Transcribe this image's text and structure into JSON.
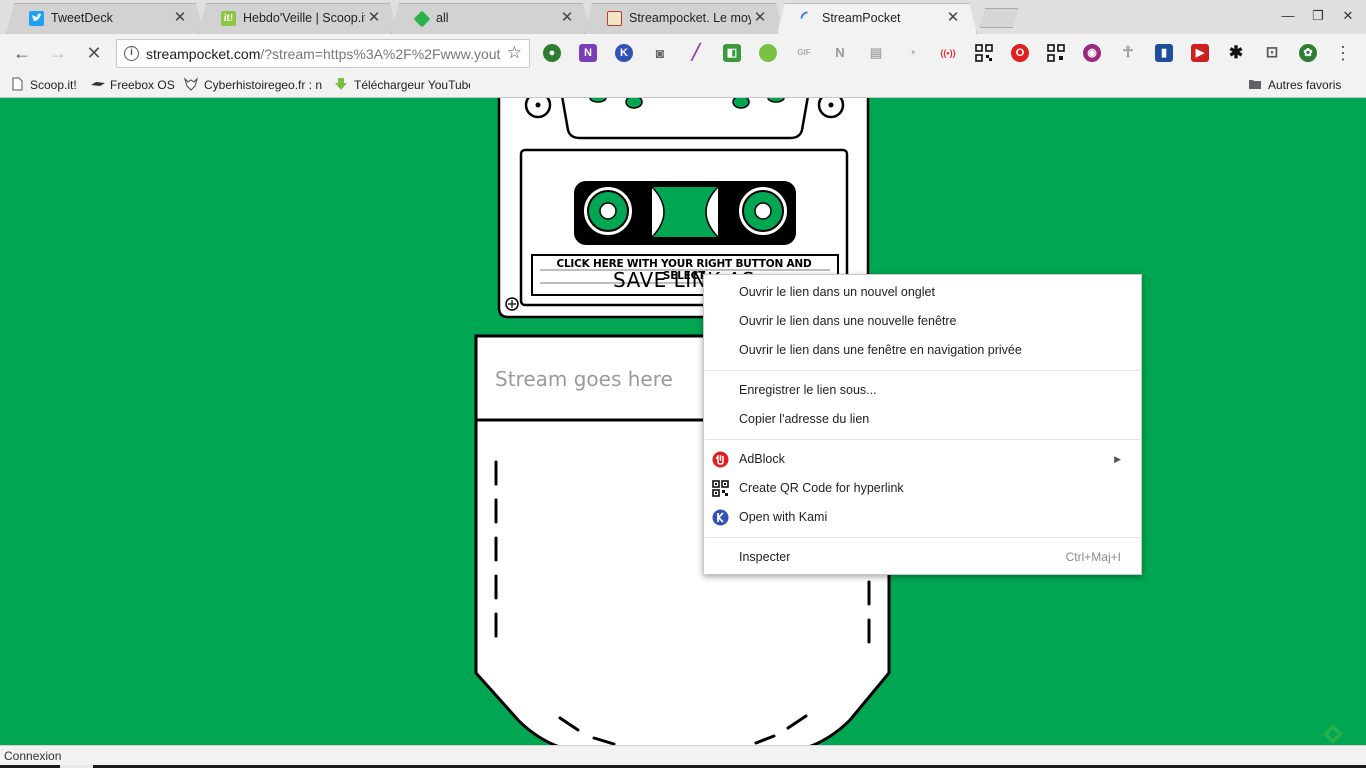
{
  "tabs": [
    {
      "title": "TweetDeck",
      "icon": "twitter-icon",
      "color": "#1da1f2"
    },
    {
      "title": "Hebdo'Veille | Scoop.it",
      "icon": "scoopit-icon",
      "color": "#8dc63f"
    },
    {
      "title": "all",
      "icon": "feedly-icon",
      "color": "#2bb24c"
    },
    {
      "title": "Streampocket. Le moye",
      "icon": "streampocket-icon",
      "color": "#c0392b"
    },
    {
      "title": "StreamPocket",
      "icon": "loading-spinner-icon",
      "color": "#888888"
    }
  ],
  "address_bar": {
    "url_host": "streampocket.com",
    "url_rest": "/?stream=https%3A%2F%2Fwww.yout"
  },
  "bookmarks": [
    {
      "label": "Scoop.it!",
      "icon": "page-icon"
    },
    {
      "label": "Freebox OS",
      "icon": "freebox-icon"
    },
    {
      "label": "Cyberhistoiregeo.fr : n",
      "icon": "wolf-icon"
    },
    {
      "label": "Téléchargeur YouTube",
      "icon": "download-arrow-icon"
    }
  ],
  "other_bookmarks": "Autres favoris",
  "page": {
    "cassette_line1": "CLICK HERE WITH YOUR RIGHT BUTTON AND SELECT",
    "cassette_line2": "SAVE LINK AS",
    "stream_placeholder": "Stream goes here",
    "background_color": "#00a651"
  },
  "context_menu": {
    "items": [
      {
        "label": "Ouvrir le lien dans un nouvel onglet"
      },
      {
        "label": "Ouvrir le lien dans une nouvelle fenêtre"
      },
      {
        "label": "Ouvrir le lien dans une fenêtre en navigation privée"
      },
      {
        "label": "Enregistrer le lien sous..."
      },
      {
        "label": "Copier l'adresse du lien"
      },
      {
        "label": "AdBlock",
        "icon": "adblock-icon",
        "submenu": true
      },
      {
        "label": "Create QR Code for hyperlink",
        "icon": "qr-code-icon"
      },
      {
        "label": "Open with Kami",
        "icon": "kami-icon"
      },
      {
        "label": "Inspecter",
        "shortcut": "Ctrl+Maj+I"
      }
    ]
  },
  "status": "Connexion"
}
